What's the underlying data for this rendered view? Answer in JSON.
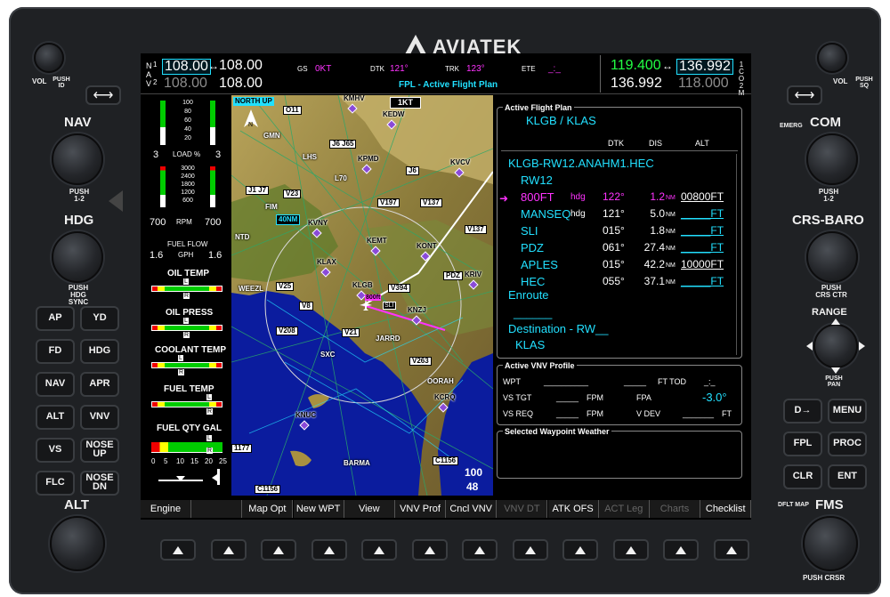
{
  "brand": "AVIATEK",
  "left_panel": {
    "vol_label": "VOL",
    "push_id_label": "PUSH ID",
    "swap_glyph": "⟷",
    "nav_label": "NAV",
    "push12_label": "PUSH 1-2",
    "hdg_label": "HDG",
    "push_hdg_sync": "PUSH HDG SYNC",
    "ap_buttons": [
      [
        "AP",
        "YD"
      ],
      [
        "FD",
        "HDG"
      ],
      [
        "NAV",
        "APR"
      ],
      [
        "ALT",
        "VNV"
      ],
      [
        "VS",
        "NOSE UP"
      ],
      [
        "FLC",
        "NOSE DN"
      ]
    ],
    "alt_label": "ALT"
  },
  "right_panel": {
    "vol_label": "VOL",
    "push_sq_label": "PUSH SQ",
    "swap_glyph": "⟷",
    "emerg_label": "EMERG",
    "com_label": "COM",
    "push12_label": "PUSH 1-2",
    "crs_baro_label": "CRS-BARO",
    "push_crs_ctr": "PUSH CRS CTR",
    "range_label": "RANGE",
    "push_pan": "PUSH PAN",
    "fms_buttons": [
      [
        "D→",
        "MENU"
      ],
      [
        "FPL",
        "PROC"
      ],
      [
        "CLR",
        "ENT"
      ]
    ],
    "dflt_map": "DFLT MAP",
    "fms_label": "FMS",
    "push_crsr": "PUSH CRSR"
  },
  "topbar": {
    "nav_tag": [
      "N",
      "A",
      "V"
    ],
    "nav1_active": "108.00",
    "nav1_standby": "108.00",
    "nav2_active": "108.00",
    "nav2_standby": "108.00",
    "gs_label": "GS",
    "gs_value": "0KT",
    "dtk_label": "DTK",
    "dtk_value": "121°",
    "trk_label": "TRK",
    "trk_value": "123°",
    "ete_label": "ETE",
    "ete_value": "_:_",
    "page_title": "FPL - Active Flight Plan",
    "com1_active": "119.400",
    "com1_standby": "136.992",
    "com2_active": "136.992",
    "com2_standby": "118.000",
    "com_tag": [
      "1",
      "C",
      "O",
      "2",
      "M"
    ],
    "swap_arrow": "↔"
  },
  "eis": {
    "manifold_ticks": [
      "100",
      "80",
      "60",
      "40",
      "20"
    ],
    "load_left": "3",
    "load_label": "LOAD %",
    "load_right": "3",
    "rpm_ticks": [
      "3000",
      "2400",
      "1800",
      "1200",
      "600"
    ],
    "rpm_left": "700",
    "rpm_label": "RPM",
    "rpm_right": "700",
    "fuel_flow_label": "FUEL FLOW",
    "fuel_flow_unit": "GPH",
    "fuel_flow_left": "1.6",
    "fuel_flow_right": "1.6",
    "oil_temp": "OIL TEMP",
    "oil_press": "OIL PRESS",
    "coolant_temp": "COOLANT TEMP",
    "fuel_temp": "FUEL TEMP",
    "fuel_qty": "FUEL QTY GAL",
    "marker_l": "L",
    "marker_r": "R",
    "fuel_scale": [
      "0",
      "5",
      "10",
      "15",
      "20",
      "25"
    ]
  },
  "map": {
    "north_up": "NORTH UP",
    "range_ring": "40NM",
    "scale": "1KT",
    "range_value": "100",
    "range_value2": "48",
    "labels": [
      {
        "t": "KMHV",
        "k": "apt"
      },
      {
        "t": "O11",
        "k": "box"
      },
      {
        "t": "KEDW",
        "k": "apt"
      },
      {
        "t": "GMN",
        "k": "vor"
      },
      {
        "t": "LHS",
        "k": "vor"
      },
      {
        "t": "J6 J65",
        "k": "box"
      },
      {
        "t": "KPMD",
        "k": "apt"
      },
      {
        "t": "J6",
        "k": "box"
      },
      {
        "t": "KVCV",
        "k": "apt"
      },
      {
        "t": "L70",
        "k": "vor"
      },
      {
        "t": "J1 J7",
        "k": "box"
      },
      {
        "t": "V23",
        "k": "box"
      },
      {
        "t": "FIM",
        "k": "vor"
      },
      {
        "t": "V197",
        "k": "box"
      },
      {
        "t": "V137",
        "k": "box"
      },
      {
        "t": "KVNY",
        "k": "apt"
      },
      {
        "t": "NTD",
        "k": "vor"
      },
      {
        "t": "KEMT",
        "k": "apt"
      },
      {
        "t": "KONT",
        "k": "apt"
      },
      {
        "t": "V137",
        "k": "box"
      },
      {
        "t": "KLAX",
        "k": "apt"
      },
      {
        "t": "PDZ",
        "k": "box"
      },
      {
        "t": "KRIV",
        "k": "apt"
      },
      {
        "t": "WEEZL",
        "k": "vor"
      },
      {
        "t": "V25",
        "k": "box"
      },
      {
        "t": "KLGB",
        "k": "apt"
      },
      {
        "t": "V394",
        "k": "box"
      },
      {
        "t": "V8",
        "k": "box"
      },
      {
        "t": "KNZJ",
        "k": "apt"
      },
      {
        "t": "V208",
        "k": "box"
      },
      {
        "t": "V21",
        "k": "box"
      },
      {
        "t": "JARRD",
        "k": "vor"
      },
      {
        "t": "SXC",
        "k": "vor"
      },
      {
        "t": "V263",
        "k": "box"
      },
      {
        "t": "OORAH",
        "k": "vor"
      },
      {
        "t": "KCRQ",
        "k": "apt"
      },
      {
        "t": "KNUC",
        "k": "apt"
      },
      {
        "t": "1177",
        "k": "box"
      },
      {
        "t": "BARMA",
        "k": "vor"
      },
      {
        "t": "C1156",
        "k": "box"
      },
      {
        "t": "C1156",
        "k": "box"
      }
    ],
    "ownship_tag": "800ft",
    "ownship_sub": "SLI"
  },
  "fpl": {
    "title": "Active Flight Plan",
    "origin_dest": "KLGB / KLAS",
    "col_dtk": "DTK",
    "col_dis": "DIS",
    "col_alt": "ALT",
    "route": "KLGB-RW12.ANAHM1.HEC",
    "rw": "RW12",
    "active_arrow": "➜",
    "rows": [
      {
        "wpt": "800FT",
        "hdg": "hdg",
        "dtk": "122°",
        "dis": "1.2",
        "unit": "NM",
        "alt": "00800FT",
        "active": true
      },
      {
        "wpt": "MANSEQ",
        "hdg": "hdg",
        "dtk": "121°",
        "dis": "5.0",
        "unit": "NM",
        "alt": "_____FT",
        "active": false
      },
      {
        "wpt": "SLI",
        "hdg": "",
        "dtk": "015°",
        "dis": "1.8",
        "unit": "NM",
        "alt": "_____FT",
        "active": false
      },
      {
        "wpt": "PDZ",
        "hdg": "",
        "dtk": "061°",
        "dis": "27.4",
        "unit": "NM",
        "alt": "_____FT",
        "active": false
      },
      {
        "wpt": "APLES",
        "hdg": "",
        "dtk": "015°",
        "dis": "42.2",
        "unit": "NM",
        "alt": "10000FT",
        "active": false
      },
      {
        "wpt": "HEC",
        "hdg": "",
        "dtk": "055°",
        "dis": "37.1",
        "unit": "NM",
        "alt": "_____FT",
        "active": false
      }
    ],
    "enroute": "Enroute",
    "blank": "______",
    "destination": "Destination - RW__",
    "dest_apt": "KLAS"
  },
  "vnv": {
    "title": "Active VNV Profile",
    "wpt_label": "WPT",
    "wpt_value": "__________",
    "ft_tod_value": "_____",
    "ft_tod_label": "FT TOD",
    "tod_time": "_:_",
    "vs_tgt_label": "VS TGT",
    "vs_tgt_value": "_____",
    "fpm": "FPM",
    "fpa_label": "FPA",
    "fpa_value": "-3.0°",
    "vs_req_label": "VS REQ",
    "vs_req_value": "_____",
    "vdev_label": "V DEV",
    "vdev_value": "_______",
    "ft": "FT"
  },
  "wx": {
    "title": "Selected Waypoint Weather"
  },
  "softkeys": [
    {
      "label": "Engine",
      "dim": false
    },
    {
      "label": "",
      "dim": false
    },
    {
      "label": "Map Opt",
      "dim": false
    },
    {
      "label": "New WPT",
      "dim": false
    },
    {
      "label": "View",
      "dim": false
    },
    {
      "label": "VNV Prof",
      "dim": false
    },
    {
      "label": "Cncl VNV",
      "dim": false
    },
    {
      "label": "VNV DT",
      "dim": true
    },
    {
      "label": "ATK OFS",
      "dim": false
    },
    {
      "label": "ACT Leg",
      "dim": true
    },
    {
      "label": "Charts",
      "dim": true
    },
    {
      "label": "Checklist",
      "dim": false
    }
  ],
  "colors": {
    "cyan": "#22e0ff",
    "magenta": "#ff33ff",
    "green": "#22ff44",
    "gray": "#8c8c8c"
  }
}
